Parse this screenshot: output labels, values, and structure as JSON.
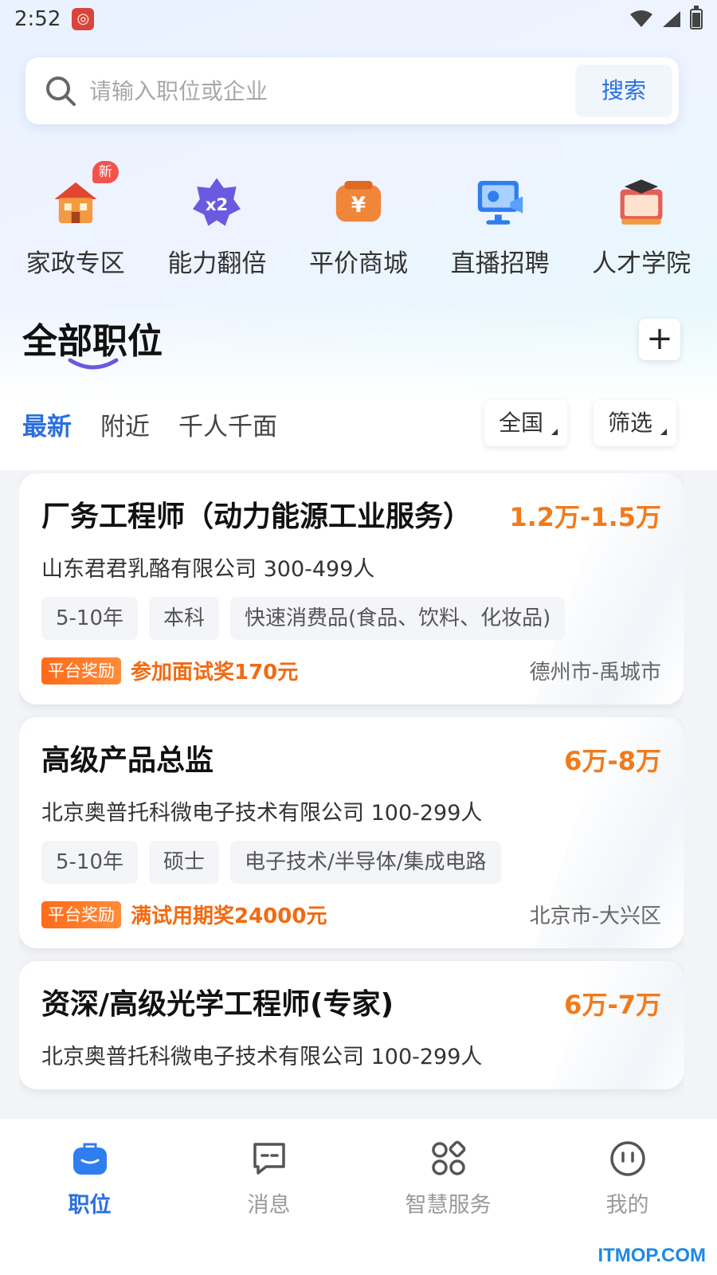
{
  "status_bar": {
    "time": "2:52"
  },
  "search": {
    "placeholder": "请输入职位或企业",
    "button_label": "搜索"
  },
  "quick_nav": [
    {
      "label": "家政专区",
      "icon": "house-icon",
      "badge": "新"
    },
    {
      "label": "能力翻倍",
      "icon": "double-star-icon"
    },
    {
      "label": "平价商城",
      "icon": "yuan-wallet-icon"
    },
    {
      "label": "直播招聘",
      "icon": "live-stream-icon"
    },
    {
      "label": "人才学院",
      "icon": "academy-icon"
    }
  ],
  "section": {
    "title": "全部职位"
  },
  "tabs": [
    {
      "label": "最新",
      "active": true
    },
    {
      "label": "附近"
    },
    {
      "label": "千人千面"
    }
  ],
  "filters": {
    "region": "全国",
    "more": "筛选"
  },
  "jobs": [
    {
      "title": "厂务工程师（动力能源工业服务）",
      "salary": "1.2万-1.5万",
      "company": "山东君君乳酪有限公司 300-499人",
      "tags": [
        "5-10年",
        "本科",
        "快速消费品(食品、饮料、化妆品)"
      ],
      "reward_badge": "平台奖励",
      "reward_text": "参加面试奖170元",
      "location": "德州市-禹城市"
    },
    {
      "title": "高级产品总监",
      "salary": "6万-8万",
      "company": "北京奥普托科微电子技术有限公司 100-299人",
      "tags": [
        "5-10年",
        "硕士",
        "电子技术/半导体/集成电路"
      ],
      "reward_badge": "平台奖励",
      "reward_text": "满试用期奖24000元",
      "location": "北京市-大兴区"
    },
    {
      "title": "资深/高级光学工程师(专家)",
      "salary": "6万-7万",
      "company": "北京奥普托科微电子技术有限公司 100-299人"
    }
  ],
  "bottom_nav": [
    {
      "label": "职位",
      "icon": "briefcase-icon",
      "active": true
    },
    {
      "label": "消息",
      "icon": "message-icon"
    },
    {
      "label": "智慧服务",
      "icon": "apps-icon"
    },
    {
      "label": "我的",
      "icon": "smiley-icon"
    }
  ],
  "watermark": "ITMOP.COM",
  "colors": {
    "accent": "#2a6fe0",
    "salary": "#f27a1a",
    "badge_red": "#f2544c"
  }
}
